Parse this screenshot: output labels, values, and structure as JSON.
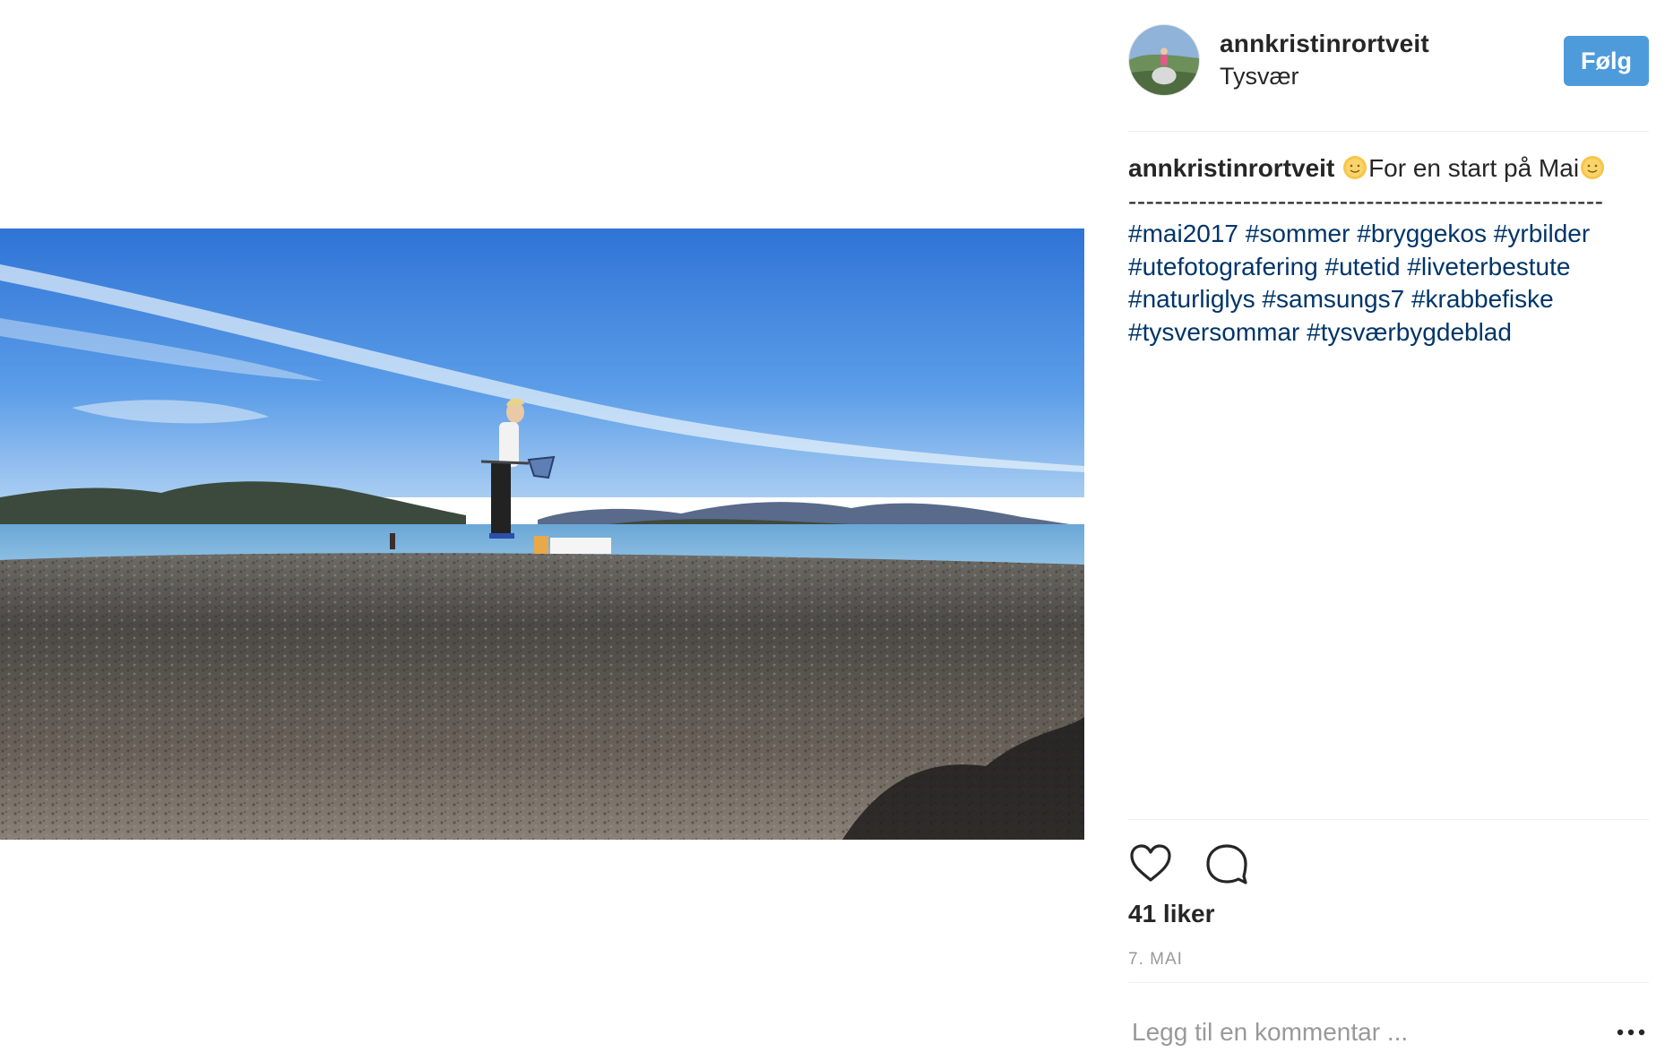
{
  "post": {
    "username": "annkristinrortveit",
    "location": "Tysvær",
    "follow_label": "Følg",
    "caption": {
      "author": "annkristinrortveit",
      "emoji_before": "sun-face",
      "text": "For en start på Mai",
      "emoji_after": "sun-face",
      "dashes": "------------------------------------------------------",
      "hashtags": [
        "#mai2017",
        "#sommer",
        "#bryggekos",
        "#yrbilder",
        "#utefotografering",
        "#utetid",
        "#liveterbestute",
        "#naturliglys",
        "#samsungs7",
        "#krabbefiske",
        "#tysversommar",
        "#tysværbygdeblad"
      ]
    },
    "likes_text": "41 liker",
    "date": "7. MAI",
    "comment_placeholder": "Legg til en kommentar ...",
    "icons": {
      "like": "heart-outline-icon",
      "comment": "speech-bubble-icon",
      "more": "ellipsis-icon"
    },
    "colors": {
      "follow_button": "#4e9bdc",
      "hashtag": "#003569",
      "muted": "#999999"
    }
  }
}
